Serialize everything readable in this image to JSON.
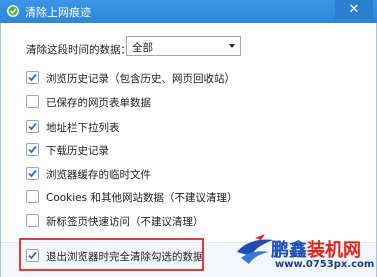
{
  "window": {
    "title": "清除上网痕迹",
    "close": "✕"
  },
  "time_range": {
    "label": "清除这段时间的数据：",
    "selected": "全部"
  },
  "options": [
    {
      "label": "浏览历史记录（包含历史、网页回收站）",
      "checked": true
    },
    {
      "label": "已保存的网页表单数据",
      "checked": false
    },
    {
      "label": "地址栏下拉列表",
      "checked": true
    },
    {
      "label": "下载历史记录",
      "checked": true
    },
    {
      "label": "浏览器缓存的临时文件",
      "checked": true
    },
    {
      "label": "Cookies 和其他网站数据（不建议清理）",
      "checked": false
    },
    {
      "label": "新标签页快速访问（不建议清理）",
      "checked": false
    }
  ],
  "exit_option": {
    "label": "退出浏览器时完全清除勾选的数据",
    "checked": true
  },
  "watermark": {
    "brand_part1": "鹏鑫",
    "brand_part2": "装机网",
    "url": "www.0753px.com"
  },
  "colors": {
    "title_bar": "#2f86d8",
    "highlight": "#e13a3a",
    "check": "#2a6fd1",
    "brand_blue": "#1b4fb5",
    "brand_red": "#e2231a"
  }
}
